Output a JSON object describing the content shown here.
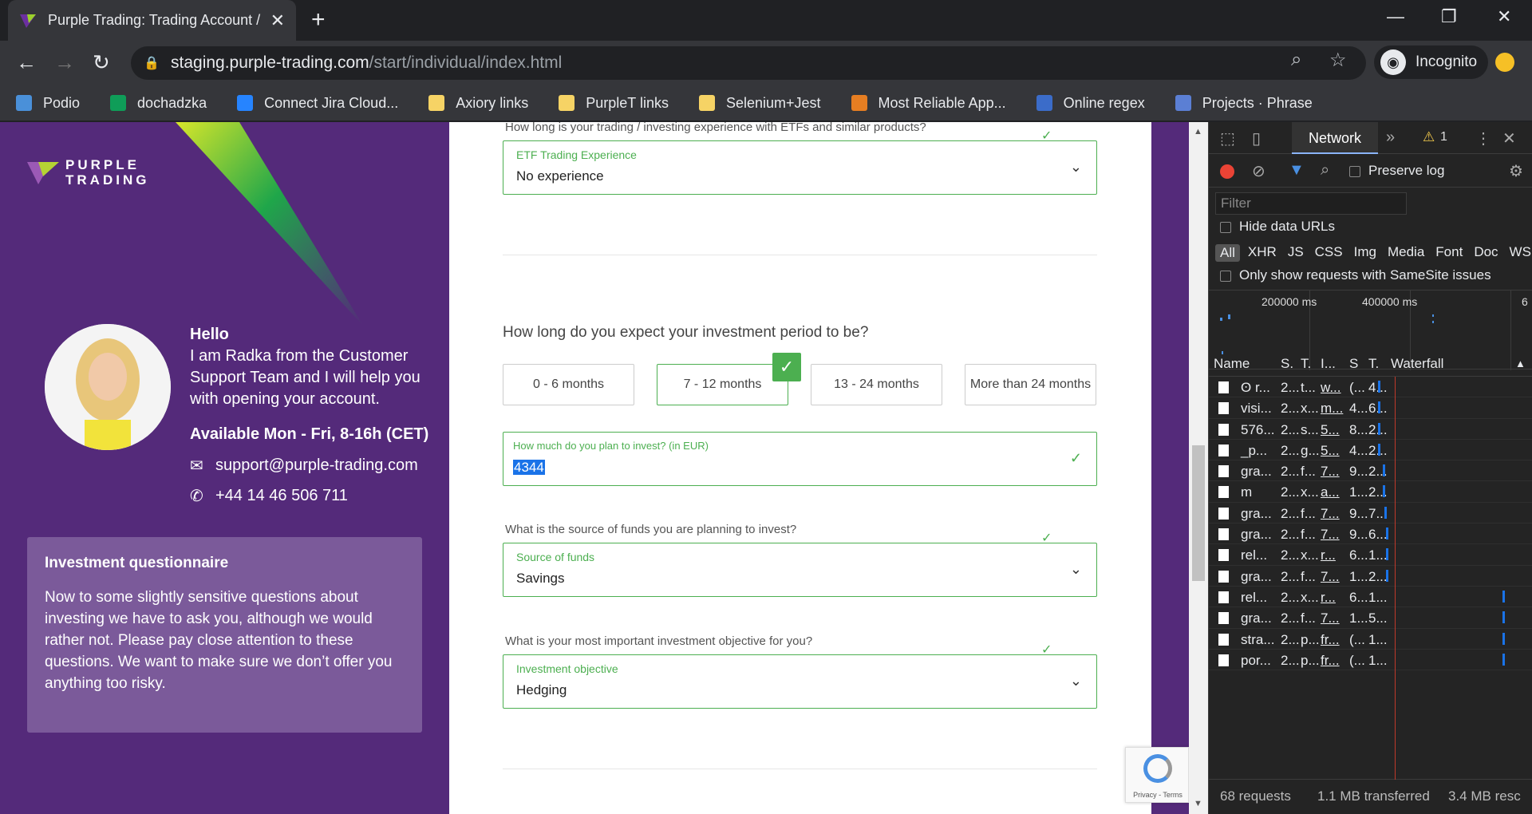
{
  "browser": {
    "tab_title": "Purple Trading: Trading Account / ...",
    "url_host": "staging.purple-trading.com",
    "url_path": "/start/individual/index.html",
    "profile": "Incognito",
    "bookmarks": [
      {
        "label": "Podio",
        "color": "#4a90d9"
      },
      {
        "label": "dochadzka",
        "color": "#0f9d58"
      },
      {
        "label": "Connect Jira Cloud...",
        "color": "#2684ff"
      },
      {
        "label": "Axiory links",
        "color": "#f6d365"
      },
      {
        "label": "PurpleT links",
        "color": "#f6d365"
      },
      {
        "label": "Selenium+Jest",
        "color": "#f6d365"
      },
      {
        "label": "Most Reliable App...",
        "color": "#e67e22"
      },
      {
        "label": "Online regex",
        "color": "#3b6cc9"
      },
      {
        "label": "Projects · Phrase",
        "color": "#5b7fd4"
      }
    ]
  },
  "sidebar": {
    "logo_line1": "PURPLE",
    "logo_line2": "TRADING",
    "hello": "Hello",
    "intro": "I am Radka from the Customer Support Team and I will help you with opening your account.",
    "available": "Available Mon - Fri, 8-16h (CET)",
    "email": "support@purple-trading.com",
    "phone": "+44 14 46 506 711",
    "questionnaire_title": "Investment questionnaire",
    "questionnaire_text": "Now to some slightly sensitive questions about investing we have to ask you, although we would rather not. Please pay close attention to these questions. We want to make sure we don’t offer you anything too risky."
  },
  "form": {
    "etf_question": "How long is your trading / investing experience with ETFs and similar products?",
    "etf_label": "ETF Trading Experience",
    "etf_value": "No experience",
    "period_question": "How long do you expect your investment period to be?",
    "period_options": [
      "0 - 6 months",
      "7 - 12 months",
      "13 - 24 months",
      "More than 24 months"
    ],
    "period_selected": "7 - 12 months",
    "invest_label": "How much do you plan to invest? (in EUR)",
    "invest_value": "4344",
    "funds_question": "What is the source of funds you are planning to invest?",
    "funds_label": "Source of funds",
    "funds_value": "Savings",
    "objective_question": "What is your most important investment objective for you?",
    "objective_label": "Investment objective",
    "objective_value": "Hedging",
    "recaptcha_text": "Privacy - Terms"
  },
  "devtools": {
    "active_tab": "Network",
    "warning_count": "1",
    "preserve_log": "Preserve log",
    "filter_placeholder": "Filter",
    "hide_data_urls": "Hide data URLs",
    "types": [
      "All",
      "XHR",
      "JS",
      "CSS",
      "Img",
      "Media",
      "Font",
      "Doc",
      "WS"
    ],
    "samesite": "Only show requests with SameSite issues",
    "timeline_labels": [
      "200000 ms",
      "400000 ms",
      "6"
    ],
    "columns": [
      "Name",
      "S.",
      "T.",
      "I...",
      "S",
      "T.",
      "Waterfall"
    ],
    "rows": [
      [
        "ʘ r...",
        "2...",
        "t...",
        "w...",
        "(...",
        "4..."
      ],
      [
        "visi...",
        "2...",
        "x...",
        "m...",
        "4...",
        "6..."
      ],
      [
        "576...",
        "2...",
        "s...",
        "5...",
        "8...",
        "2..."
      ],
      [
        "_p...",
        "2...",
        "g...",
        "5...",
        "4...",
        "2..."
      ],
      [
        "gra...",
        "2...",
        "f...",
        "7...",
        "9...",
        "2..."
      ],
      [
        "m",
        "2...",
        "x...",
        "a...",
        "1...",
        "2..."
      ],
      [
        "gra...",
        "2...",
        "f...",
        "7...",
        "9...",
        "7..."
      ],
      [
        "gra...",
        "2...",
        "f...",
        "7...",
        "9...",
        "6..."
      ],
      [
        "rel...",
        "2...",
        "x...",
        "r...",
        "6...",
        "1..."
      ],
      [
        "gra...",
        "2...",
        "f...",
        "7...",
        "1...",
        "2..."
      ],
      [
        "rel...",
        "2...",
        "x...",
        "r...",
        "6...",
        "1..."
      ],
      [
        "gra...",
        "2...",
        "f...",
        "7...",
        "1...",
        "5..."
      ],
      [
        "stra...",
        "2...",
        "p...",
        "fr...",
        "(...",
        "1..."
      ],
      [
        "por...",
        "2...",
        "p...",
        "fr...",
        "(...",
        "1..."
      ]
    ],
    "footer_requests": "68 requests",
    "footer_transferred": "1.1 MB transferred",
    "footer_resources": "3.4 MB resc"
  }
}
